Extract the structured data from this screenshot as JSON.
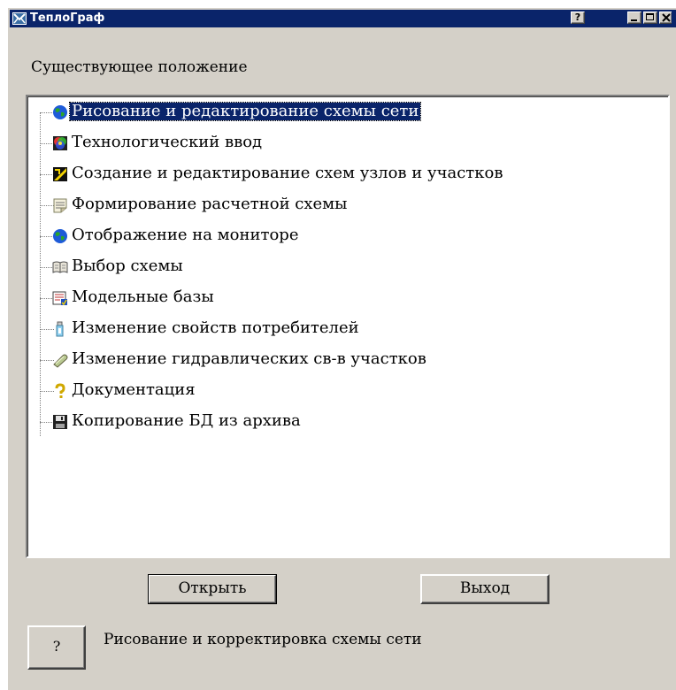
{
  "window": {
    "title": "ТеплоГраф",
    "help_glyph": "?",
    "colors": {
      "titlebar": "#0a246a",
      "face": "#d4d0c8",
      "selection": "#0a246a"
    }
  },
  "heading": "Существующее положение",
  "tree": {
    "selected_index": 0,
    "items": [
      {
        "label": "Рисование и редактирование схемы сети",
        "icon": "globe-icon"
      },
      {
        "label": "Технологический ввод",
        "icon": "color-wheel-icon"
      },
      {
        "label": "Создание и редактирование схем узлов и участков",
        "icon": "scheme-editor-icon"
      },
      {
        "label": "Формирование расчетной схемы",
        "icon": "document-icon"
      },
      {
        "label": "Отображение на мониторе",
        "icon": "globe-icon"
      },
      {
        "label": "Выбор схемы",
        "icon": "book-icon"
      },
      {
        "label": "Модельные базы",
        "icon": "database-icon"
      },
      {
        "label": "Изменение свойств потребителей",
        "icon": "consumer-icon"
      },
      {
        "label": "Изменение гидравлических св-в участков",
        "icon": "pipe-icon"
      },
      {
        "label": "Документация",
        "icon": "question-icon"
      },
      {
        "label": "Копирование БД из архива",
        "icon": "floppy-icon"
      }
    ]
  },
  "buttons": {
    "open": "Открыть",
    "exit": "Выход",
    "help": "?"
  },
  "hint": "Рисование и корректировка схемы сети"
}
